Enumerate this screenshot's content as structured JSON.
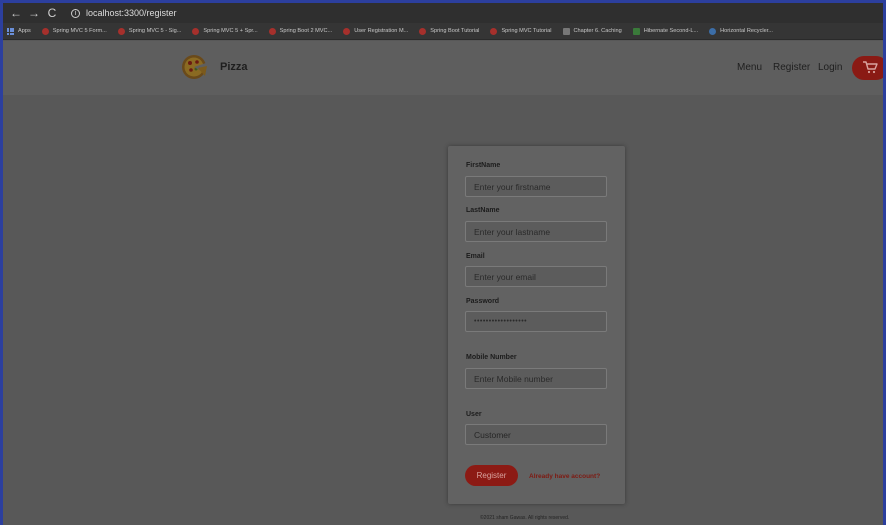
{
  "browser": {
    "back_glyph": "←",
    "forward_glyph": "→",
    "reload_glyph": "C",
    "info_glyph": "i",
    "url": "localhost:3300/register",
    "bookmarks": [
      {
        "label": "Apps",
        "icon": "apps-grid-icon"
      },
      {
        "label": "Spring MVC 5 Form...",
        "icon": "bookmark-icon"
      },
      {
        "label": "Spring MVC 5 - Sig...",
        "icon": "bookmark-icon"
      },
      {
        "label": "Spring MVC 5 + Spr...",
        "icon": "bookmark-icon"
      },
      {
        "label": "Spring Boot 2 MVC...",
        "icon": "bookmark-icon"
      },
      {
        "label": "User Registration M...",
        "icon": "bookmark-icon"
      },
      {
        "label": "Spring Boot Tutorial",
        "icon": "bookmark-icon"
      },
      {
        "label": "Spring MVC Tutorial",
        "icon": "bookmark-icon"
      },
      {
        "label": "Chapter 6. Caching",
        "icon": "bookmark-icon"
      },
      {
        "label": "Hibernate Second-L...",
        "icon": "bookmark-icon"
      },
      {
        "label": "Horizontal Recycler...",
        "icon": "bookmark-icon"
      }
    ]
  },
  "header": {
    "brand": "Pizza",
    "nav": {
      "menu": "Menu",
      "register": "Register",
      "login": "Login"
    },
    "cart_icon": "cart-icon"
  },
  "form": {
    "firstname_label": "FirstName",
    "firstname_placeholder": "Enter your firstname",
    "lastname_label": "LastName",
    "lastname_placeholder": "Enter your lastname",
    "email_label": "Email",
    "email_placeholder": "Enter your email",
    "password_label": "Password",
    "password_value": "••••••••••••••••••",
    "mobile_label": "Mobile Number",
    "mobile_placeholder": "Enter Mobile number",
    "user_label": "User",
    "user_value": "Customer",
    "register_button": "Register",
    "signin_link": "Already have account?"
  },
  "footer": {
    "text": "©2021 sham Gawas. All rights reserved."
  },
  "colors": {
    "accent": "#8c1a14",
    "overlay": "#585858"
  }
}
